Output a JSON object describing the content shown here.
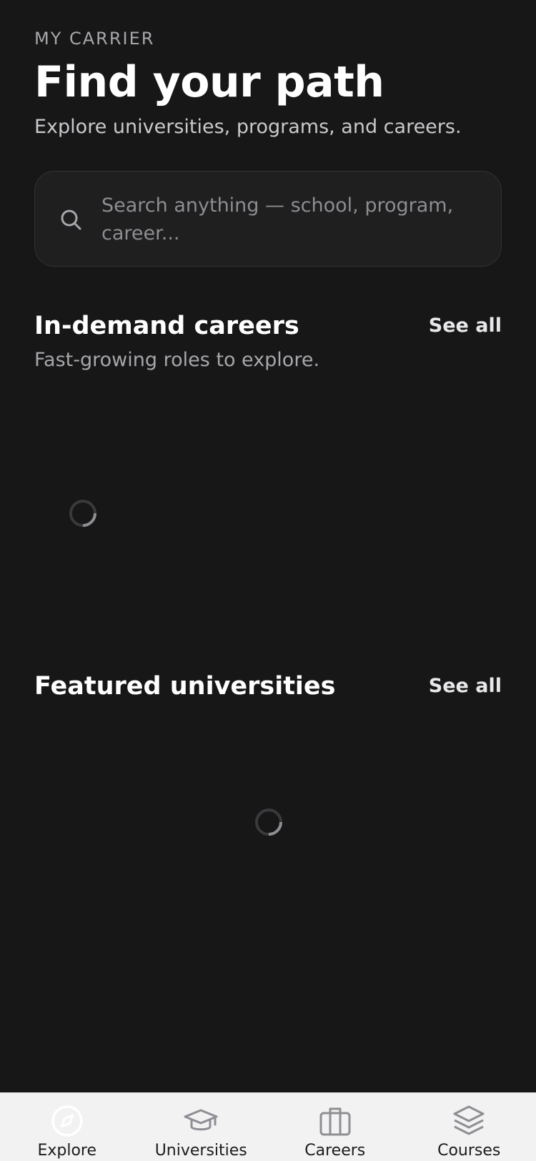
{
  "header": {
    "eyebrow": "MY CARRIER",
    "title": "Find your path",
    "subtitle": "Explore universities, programs, and careers."
  },
  "search": {
    "placeholder": "Search anything — school, program, career...",
    "icon": "search-icon"
  },
  "sections": {
    "careers": {
      "title": "In-demand careers",
      "subtitle": "Fast-growing roles to explore.",
      "see_all": "See all",
      "loading": true
    },
    "universities": {
      "title": "Featured universities",
      "see_all": "See all",
      "loading": true
    }
  },
  "tabbar": {
    "active": "explore",
    "items": [
      {
        "label": "Explore",
        "icon": "compass-icon"
      },
      {
        "label": "Universities",
        "icon": "graduation-cap-icon"
      },
      {
        "label": "Careers",
        "icon": "briefcase-icon"
      },
      {
        "label": "Courses",
        "icon": "layers-icon"
      }
    ]
  },
  "colors": {
    "background": "#171718",
    "text_primary": "#ffffff",
    "text_secondary": "#a7a7ab",
    "search_bg": "#1f1f20",
    "tabbar_bg": "#f2f2f3",
    "tab_icon_inactive": "#8e8e93",
    "tab_icon_active": "#ffffff"
  }
}
